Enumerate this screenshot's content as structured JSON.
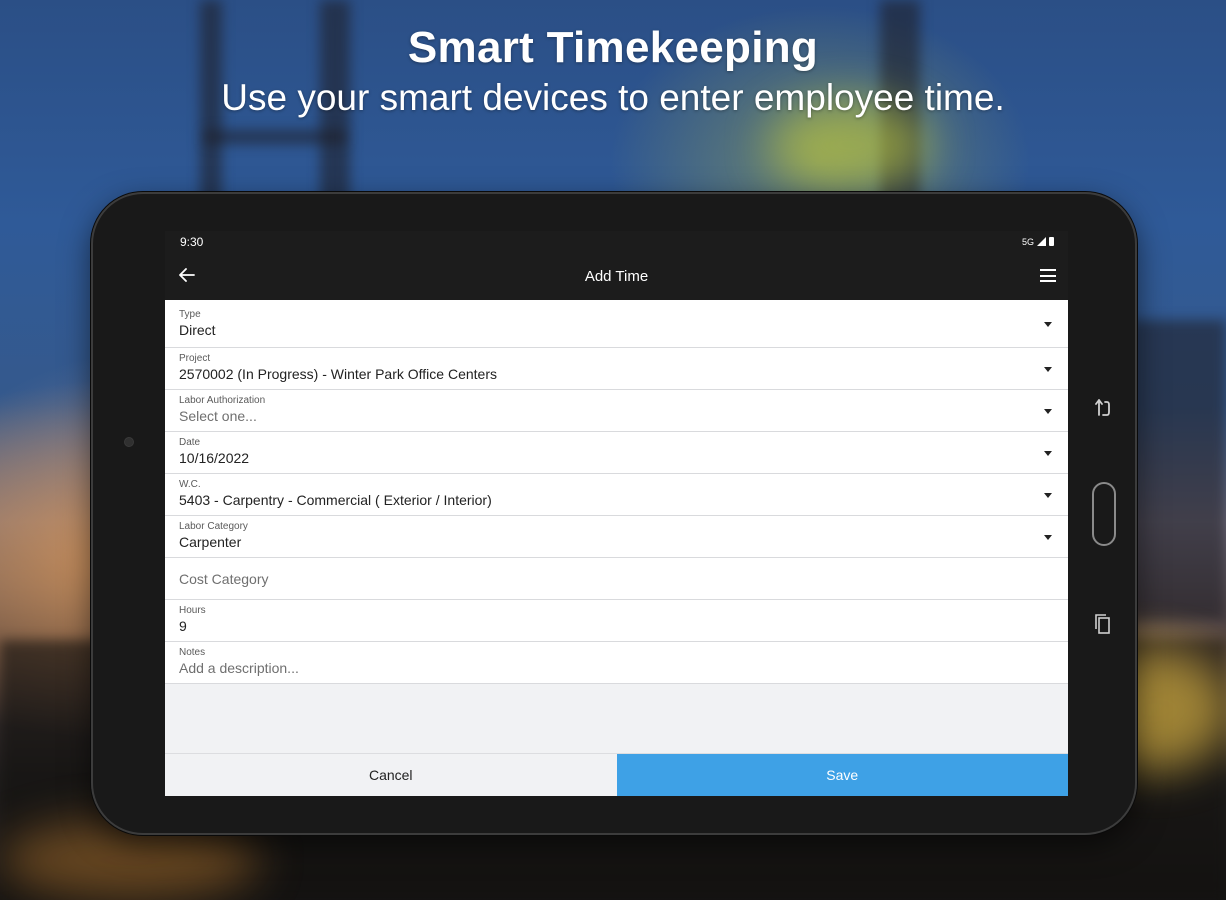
{
  "headline": {
    "title": "Smart Timekeeping",
    "subtitle": "Use your smart devices to enter employee time."
  },
  "status_bar": {
    "time": "9:30",
    "network": "5G"
  },
  "app_bar": {
    "title": "Add Time",
    "back_icon": "arrow-left-icon",
    "menu_icon": "hamburger-menu-icon"
  },
  "form": {
    "type": {
      "label": "Type",
      "value": "Direct"
    },
    "project": {
      "label": "Project",
      "value": "2570002 (In Progress) - Winter Park Office Centers"
    },
    "labor_authorization": {
      "label": "Labor Authorization",
      "placeholder": "Select one..."
    },
    "date": {
      "label": "Date",
      "value": "10/16/2022"
    },
    "wc": {
      "label": "W.C.",
      "value": "5403 - Carpentry - Commercial ( Exterior / Interior)"
    },
    "labor_category": {
      "label": "Labor Category",
      "value": "Carpenter"
    },
    "cost_category": {
      "placeholder": "Cost Category"
    },
    "hours": {
      "label": "Hours",
      "value": "9"
    },
    "notes": {
      "label": "Notes",
      "placeholder": "Add a description..."
    }
  },
  "actions": {
    "cancel_label": "Cancel",
    "save_label": "Save"
  },
  "colors": {
    "app_bar": "#1c1c1c",
    "save_button": "#3ea1e6",
    "cancel_button": "#f1f2f4",
    "form_background": "#f1f2f4"
  },
  "device_buttons": {
    "back_icon": "hardware-back-icon",
    "home_icon": "home-button-icon",
    "recent_icon": "recent-apps-icon"
  }
}
